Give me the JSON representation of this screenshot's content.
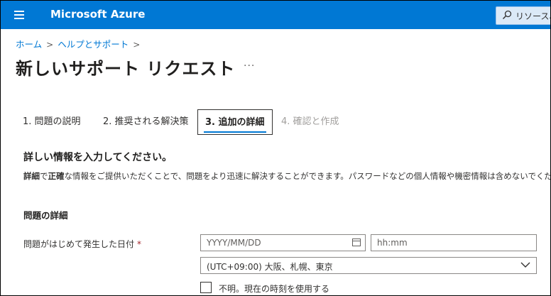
{
  "topbar": {
    "menu_icon": "hamburger-menu-icon",
    "brand": "Microsoft Azure",
    "search_icon": "search-icon",
    "search_label": "リソース、",
    "background": "#0078d4"
  },
  "breadcrumb": {
    "items": [
      "ホーム",
      "ヘルプとサポート"
    ],
    "separator": ">"
  },
  "page": {
    "title": "新しいサポート リクエスト",
    "more": "···"
  },
  "steps": [
    {
      "label": "1. 問題の説明",
      "state": "done"
    },
    {
      "label": "2. 推奨される解決策",
      "state": "done"
    },
    {
      "label": "3. 追加の詳細",
      "state": "active"
    },
    {
      "label": "4. 確認と作成",
      "state": "disabled"
    }
  ],
  "details": {
    "title": "詳しい情報を入力してください。",
    "desc_b1": "詳細",
    "desc_t1": "で",
    "desc_b2": "正確",
    "desc_t2": "な情報をご提供いただくことで、問題をより迅速に解決することができます。パスワードなどの個人情報や機密情報は含めないでください。"
  },
  "problem": {
    "heading": "問題の詳細",
    "date_label": "問題がはじめて発生した日付",
    "required_mark": "*",
    "date_placeholder": "YYYY/MM/DD",
    "time_placeholder": "hh:mm",
    "timezone_value": "(UTC+09:00) 大阪、札幌、東京",
    "unknown_checkbox_label": "不明。現在の時刻を使用する",
    "unknown_checked": false
  }
}
